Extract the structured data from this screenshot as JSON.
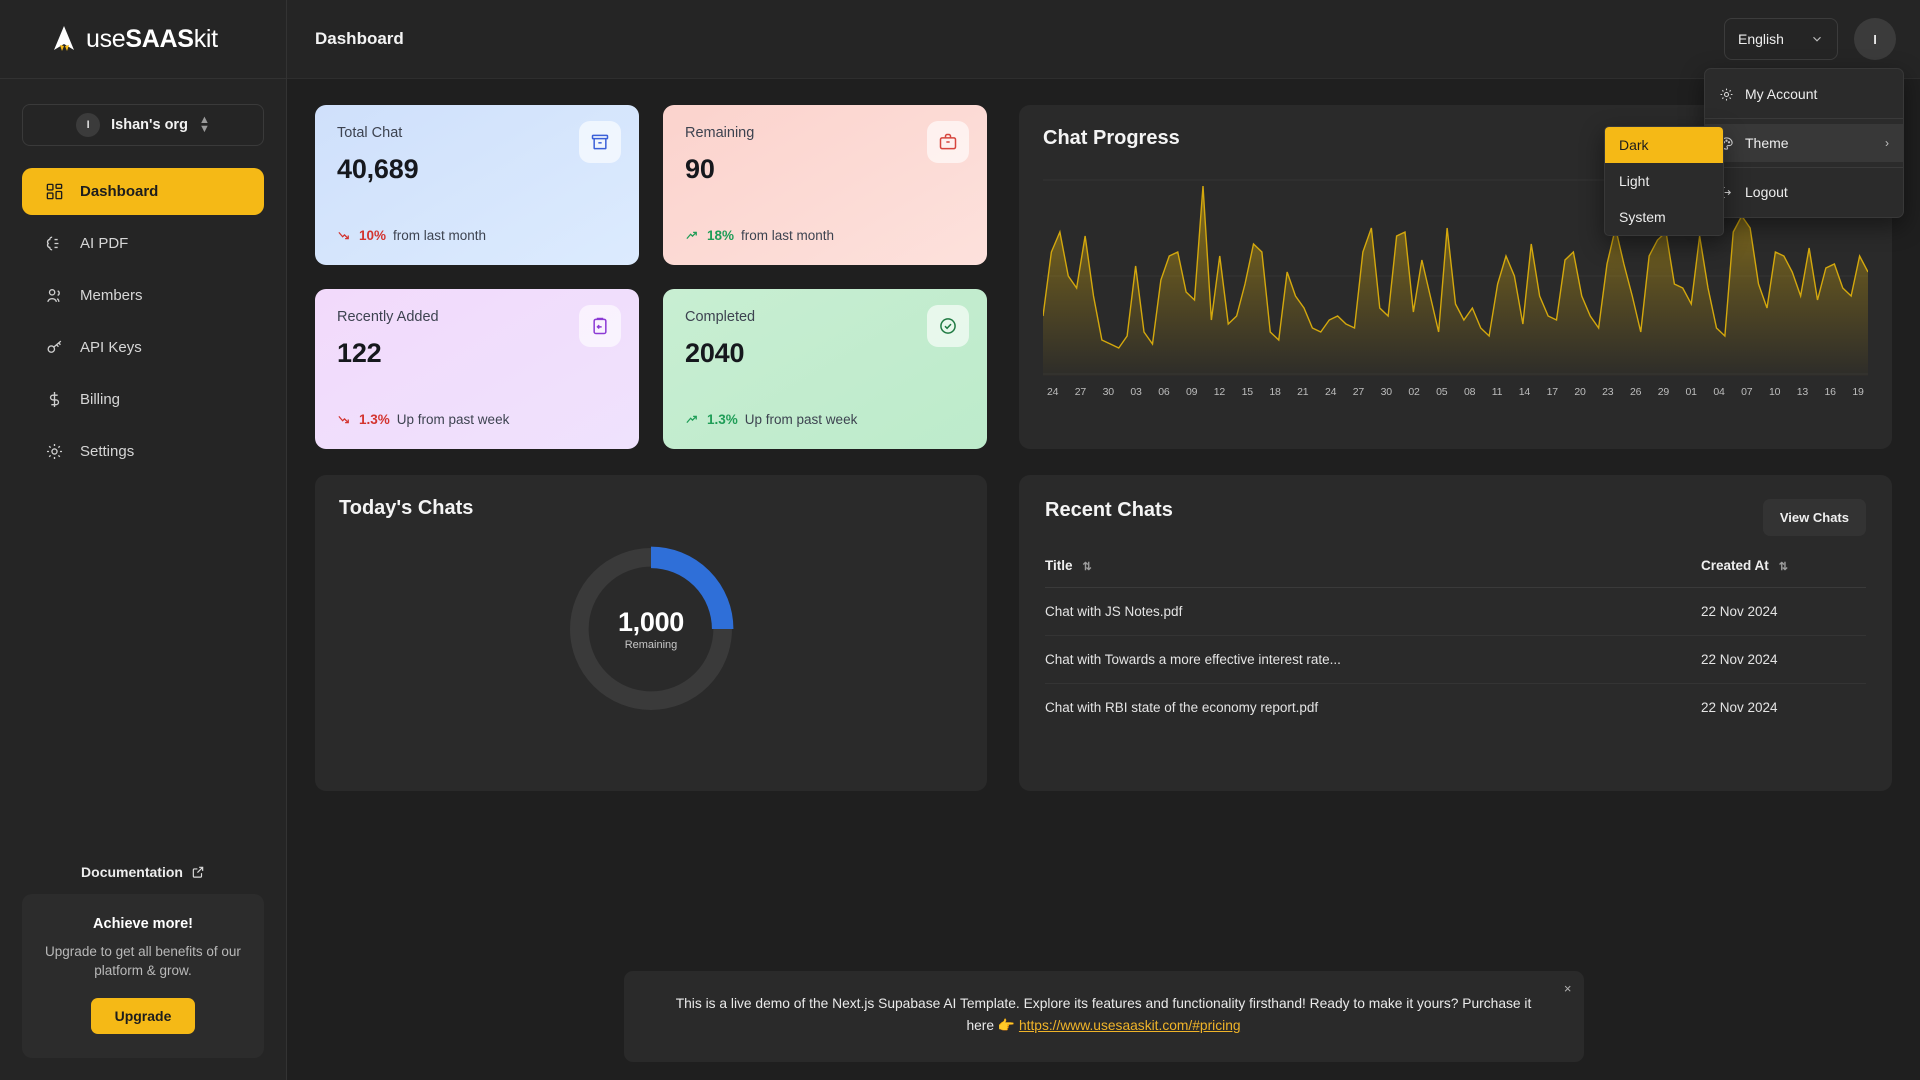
{
  "brand": {
    "name_prefix": "use",
    "name_bold": "SAAS",
    "name_suffix": "kit",
    "logo_icon": "rocket-logo-icon",
    "accent": "#f5b916"
  },
  "sidebar": {
    "org": {
      "initial": "I",
      "name": "Ishan's org",
      "switch_icon": "chevron-updown-icon"
    },
    "items": [
      {
        "label": "Dashboard",
        "icon": "dashboard-grid-icon",
        "active": true
      },
      {
        "label": "AI PDF",
        "icon": "ai-brain-icon",
        "active": false
      },
      {
        "label": "Members",
        "icon": "users-icon",
        "active": false
      },
      {
        "label": "API Keys",
        "icon": "key-icon",
        "active": false
      },
      {
        "label": "Billing",
        "icon": "dollar-icon",
        "active": false
      },
      {
        "label": "Settings",
        "icon": "gear-icon",
        "active": false
      }
    ],
    "documentation": {
      "label": "Documentation",
      "icon": "external-link-icon"
    },
    "upgrade_card": {
      "title": "Achieve more!",
      "subtitle": "Upgrade to get all benefits of our platform & grow.",
      "button": "Upgrade"
    }
  },
  "topbar": {
    "page_title": "Dashboard",
    "language": {
      "value": "English",
      "icon": "chevron-down-icon"
    },
    "avatar_initial": "I"
  },
  "user_menu": {
    "items": [
      {
        "label": "My Account",
        "icon": "gear-icon",
        "highlighted": false,
        "has_submenu": false
      },
      {
        "label": "Theme",
        "icon": "palette-icon",
        "highlighted": true,
        "has_submenu": true,
        "submenu_icon": "chevron-right-icon"
      },
      {
        "label": "Logout",
        "icon": "logout-icon",
        "highlighted": false,
        "has_submenu": false
      }
    ],
    "theme_submenu": {
      "options": [
        {
          "label": "Dark",
          "active": true
        },
        {
          "label": "Light",
          "active": false
        },
        {
          "label": "System",
          "active": false
        }
      ]
    }
  },
  "stats": [
    {
      "label": "Total Chat",
      "value": "40,689",
      "pct": "10%",
      "trend_text": "from last month",
      "direction": "down",
      "icon": "archive-box-icon",
      "bg_from": "#cfe0fb",
      "bg_to": "#d8e8fd",
      "icon_color": "#3b60d8",
      "pct_color": "#d3342f"
    },
    {
      "label": "Remaining",
      "value": "90",
      "pct": "18%",
      "trend_text": "from last month",
      "direction": "up",
      "icon": "briefcase-icon",
      "bg_from": "#fbd4cf",
      "bg_to": "#fcdcd7",
      "icon_color": "#d6453d",
      "pct_color": "#1f9d57"
    },
    {
      "label": "Recently Added",
      "value": "122",
      "pct": "1.3%",
      "trend_text": "Up from past week",
      "direction": "down",
      "icon": "clipboard-import-icon",
      "bg_from": "#f1d9fb",
      "bg_to": "#efe0fc",
      "icon_color": "#8b3ad4",
      "pct_color": "#d3342f"
    },
    {
      "label": "Completed",
      "value": "2040",
      "pct": "1.3%",
      "trend_text": "Up from past week",
      "direction": "up",
      "icon": "check-circle-icon",
      "bg_from": "#c9eed3",
      "bg_to": "#bdeccc",
      "icon_color": "#1f7a42",
      "pct_color": "#1f9d57"
    }
  ],
  "todays_chats": {
    "title": "Today's Chats",
    "value": "1,000",
    "caption": "Remaining",
    "percent": 25,
    "arc_color": "#2f6fd8",
    "track_color": "#3a3a3a"
  },
  "recent_chats": {
    "title": "Recent Chats",
    "view_button": "View Chats",
    "columns": [
      {
        "label": "Title",
        "sort_icon": "sort-icon"
      },
      {
        "label": "Created At",
        "sort_icon": "sort-icon"
      }
    ],
    "rows": [
      {
        "title": "Chat with JS Notes.pdf",
        "created_at": "22 Nov 2024"
      },
      {
        "title": "Chat with Towards a more effective interest rate...",
        "created_at": "22 Nov 2024"
      },
      {
        "title": "Chat with RBI state of the economy report.pdf",
        "created_at": "22 Nov 2024"
      }
    ]
  },
  "banner": {
    "line1": "This is a live demo of the Next.js Supabase AI Template. Explore its features and functionality firsthand! Ready to make it",
    "line2": "yours? Purchase it here",
    "emoji": "👉",
    "link": "https://www.usesaaskit.com/#pricing",
    "close_icon": "close-icon"
  },
  "chart_data": {
    "type": "area",
    "title": "Chat Progress",
    "xlabel": "",
    "ylabel": "",
    "grid": true,
    "legend": null,
    "line_color": "#d4a80d",
    "fill_from": "rgba(212,168,13,0.55)",
    "fill_to": "rgba(212,168,13,0.02)",
    "ylim": [
      0,
      100
    ],
    "categories": [
      "24",
      "27",
      "30",
      "03",
      "06",
      "09",
      "12",
      "15",
      "18",
      "21",
      "24",
      "27",
      "30",
      "02",
      "05",
      "08",
      "11",
      "14",
      "17",
      "20",
      "23",
      "26",
      "29",
      "01",
      "04",
      "07",
      "10",
      "13",
      "16",
      "19"
    ],
    "x": [
      0,
      1,
      2,
      3,
      4,
      5,
      6,
      7,
      8,
      9,
      10,
      11,
      12,
      13,
      14,
      15,
      16,
      17,
      18,
      19,
      20,
      21,
      22,
      23,
      24,
      25,
      26,
      27,
      28,
      29,
      30,
      31,
      32,
      33,
      34,
      35,
      36,
      37,
      38,
      39,
      40,
      41,
      42,
      43,
      44,
      45,
      46,
      47,
      48,
      49,
      50,
      51,
      52,
      53,
      54,
      55,
      56,
      57,
      58,
      59,
      60,
      61,
      62,
      63,
      64,
      65,
      66,
      67,
      68,
      69,
      70,
      71,
      72,
      73,
      74,
      75,
      76,
      77,
      78,
      79,
      80,
      81,
      82,
      83,
      84,
      85,
      86,
      87,
      88,
      89,
      90,
      91,
      92,
      93,
      94,
      95,
      96,
      97,
      98,
      99,
      100,
      101,
      102,
      103,
      104,
      105,
      106,
      107,
      108,
      109,
      110,
      111,
      112,
      113,
      114,
      115,
      116,
      117,
      118,
      119
    ],
    "values": [
      30,
      62,
      72,
      50,
      44,
      70,
      40,
      18,
      16,
      14,
      20,
      55,
      22,
      16,
      48,
      60,
      62,
      42,
      38,
      95,
      28,
      60,
      26,
      30,
      46,
      66,
      62,
      22,
      18,
      52,
      40,
      34,
      24,
      22,
      28,
      30,
      26,
      24,
      62,
      74,
      34,
      30,
      70,
      72,
      32,
      58,
      40,
      22,
      74,
      36,
      28,
      34,
      24,
      20,
      46,
      60,
      50,
      26,
      66,
      40,
      30,
      28,
      58,
      62,
      40,
      30,
      24,
      56,
      74,
      56,
      40,
      22,
      60,
      68,
      72,
      46,
      44,
      36,
      70,
      44,
      24,
      20,
      72,
      80,
      74,
      46,
      34,
      62,
      60,
      52,
      40,
      64,
      38,
      54,
      56,
      44,
      40,
      60,
      52
    ]
  }
}
